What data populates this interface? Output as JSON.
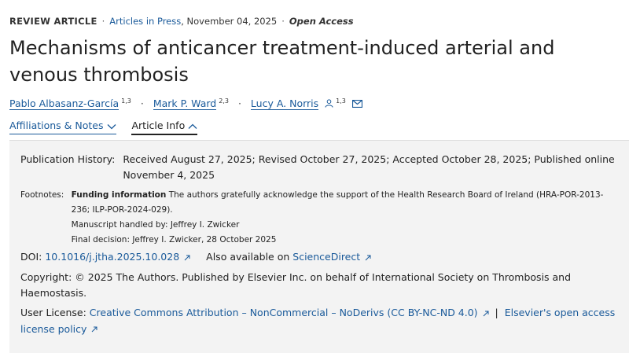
{
  "meta": {
    "article_type": "REVIEW ARTICLE",
    "section_link": "Articles in Press",
    "date": ", November 04, 2025",
    "access": "Open Access"
  },
  "title": "Mechanisms of anticancer treatment-induced arterial and venous thrombosis",
  "authors": [
    {
      "name": "Pablo Albasanz-García",
      "sup": "1,3"
    },
    {
      "name": "Mark P. Ward",
      "sup": "2,3"
    },
    {
      "name": "Lucy A. Norris",
      "sup": "1,3"
    }
  ],
  "tabs": {
    "affiliations": "Affiliations & Notes",
    "article_info": "Article Info"
  },
  "article_info": {
    "history_label": "Publication History:",
    "history_line1": "Received August 27, 2025; Revised October 27, 2025; Accepted October 28, 2025; Published online",
    "history_line2": "November 4, 2025",
    "footnotes_label": "Footnotes:",
    "funding_label": "Funding information",
    "funding_text1": " The authors gratefully acknowledge the support of the Health Research Board of Ireland (HRA-POR-2013-",
    "funding_text2": "236; ILP-POR-2024-029).",
    "handled_by": "Manuscript handled by: Jeffrey I. Zwicker",
    "final_decision": "Final decision: Jeffrey I. Zwicker, 28 October 2025",
    "doi_label": "DOI:",
    "doi_link": "10.1016/j.jtha.2025.10.028",
    "also_label": "Also available on",
    "also_link": "ScienceDirect",
    "copyright_line1": "Copyright: © 2025 The Authors. Published by Elsevier Inc. on behalf of International Society on Thrombosis and",
    "copyright_line2": "Haemostasis.",
    "license_label": "User License:",
    "license_link": "Creative Commons Attribution – NonCommercial – NoDerivs (CC BY-NC-ND 4.0)",
    "license_sep": "|",
    "oa_policy_line1": "Elsevier's open access",
    "oa_policy_line2": "license policy"
  },
  "colors": {
    "link": "#1a5a9a",
    "panel_bg": "#f3f3f3",
    "text": "#222222"
  },
  "icons": [
    "person-icon",
    "envelope-icon",
    "chevron-down-icon",
    "chevron-up-icon",
    "external-link-icon"
  ]
}
